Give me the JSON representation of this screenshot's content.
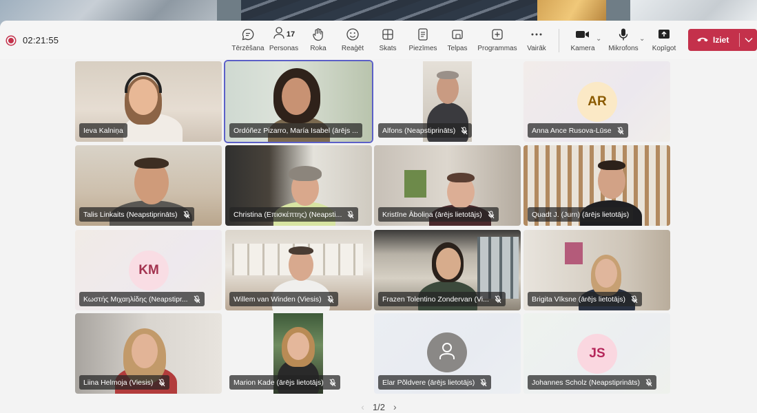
{
  "meeting": {
    "timer": "02:21:55"
  },
  "toolbar": {
    "chat": "Tērzēšana",
    "people": "Personas",
    "people_count": "17",
    "raise_hand": "Roka",
    "react": "Reaģēt",
    "view": "Skats",
    "notes": "Piezīmes",
    "rooms": "Telpas",
    "apps": "Programmas",
    "more": "Vairāk",
    "camera": "Kamera",
    "mic": "Mikrofons",
    "share": "Kopīgot",
    "leave": "Iziet"
  },
  "tiles": [
    {
      "name": "Ieva Kalniņa"
    },
    {
      "name": "Ordóñez Pizarro, María Isabel (ārējs ..."
    },
    {
      "name": "Alfons (Neapstiprināts)"
    },
    {
      "name": "Anna Ance Rusova-Lūse",
      "initials": "AR"
    },
    {
      "name": "Talis Linkaits (Neapstiprināts)"
    },
    {
      "name": "Christina (Επισκέπτης) (Neapsti..."
    },
    {
      "name": "Kristīne Āboliņa (ārējs lietotājs)"
    },
    {
      "name": "Quadt J. (Jurn) (ārējs lietotājs)"
    },
    {
      "name": "Κωστής Μιχαηλίδης (Neapstipr...",
      "initials": "KM"
    },
    {
      "name": "Willem van Winden (Viesis)"
    },
    {
      "name": "Frazen Tolentino Zondervan (Vi..."
    },
    {
      "name": "Brigita Vīksne (ārējs lietotājs)"
    },
    {
      "name": "Liina Helmoja (Viesis)"
    },
    {
      "name": "Marion Kade (ārējs lietotājs)"
    },
    {
      "name": "Elar Põldvere (ārējs lietotājs)"
    },
    {
      "name": "Johannes Scholz (Neapstiprināts)",
      "initials": "JS"
    }
  ],
  "pager": {
    "label": "1/2"
  },
  "colors": {
    "leave": "#c4314b",
    "active_border": "#5b5fc7"
  }
}
